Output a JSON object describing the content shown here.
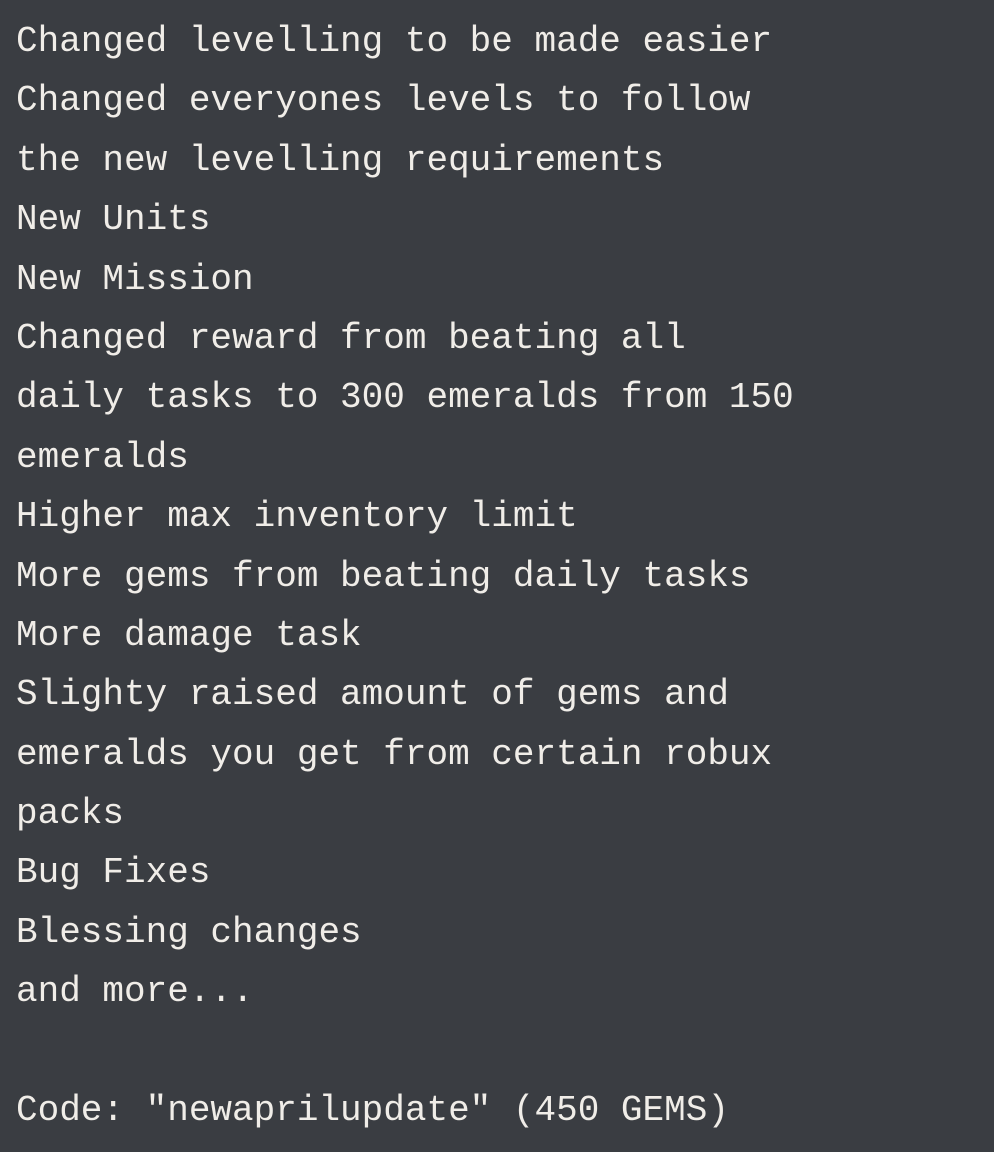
{
  "content": {
    "lines": [
      "Changed levelling to be made easier",
      "Changed everyones levels to follow",
      "the new levelling requirements",
      "New Units",
      "New Mission",
      "Changed reward from beating all",
      "daily tasks to 300 emeralds from 150",
      "emeralds",
      "Higher max inventory limit",
      "More gems from beating daily tasks",
      "More damage task",
      "Slighty raised amount of gems and",
      "emeralds you get from certain robux",
      "packs",
      "Bug Fixes",
      "Blessing changes",
      "and more...",
      "",
      "Code: \"newaprilupdate\" (450 GEMS)"
    ]
  },
  "background_color": "#3a3d42",
  "text_color": "#f0ede8"
}
